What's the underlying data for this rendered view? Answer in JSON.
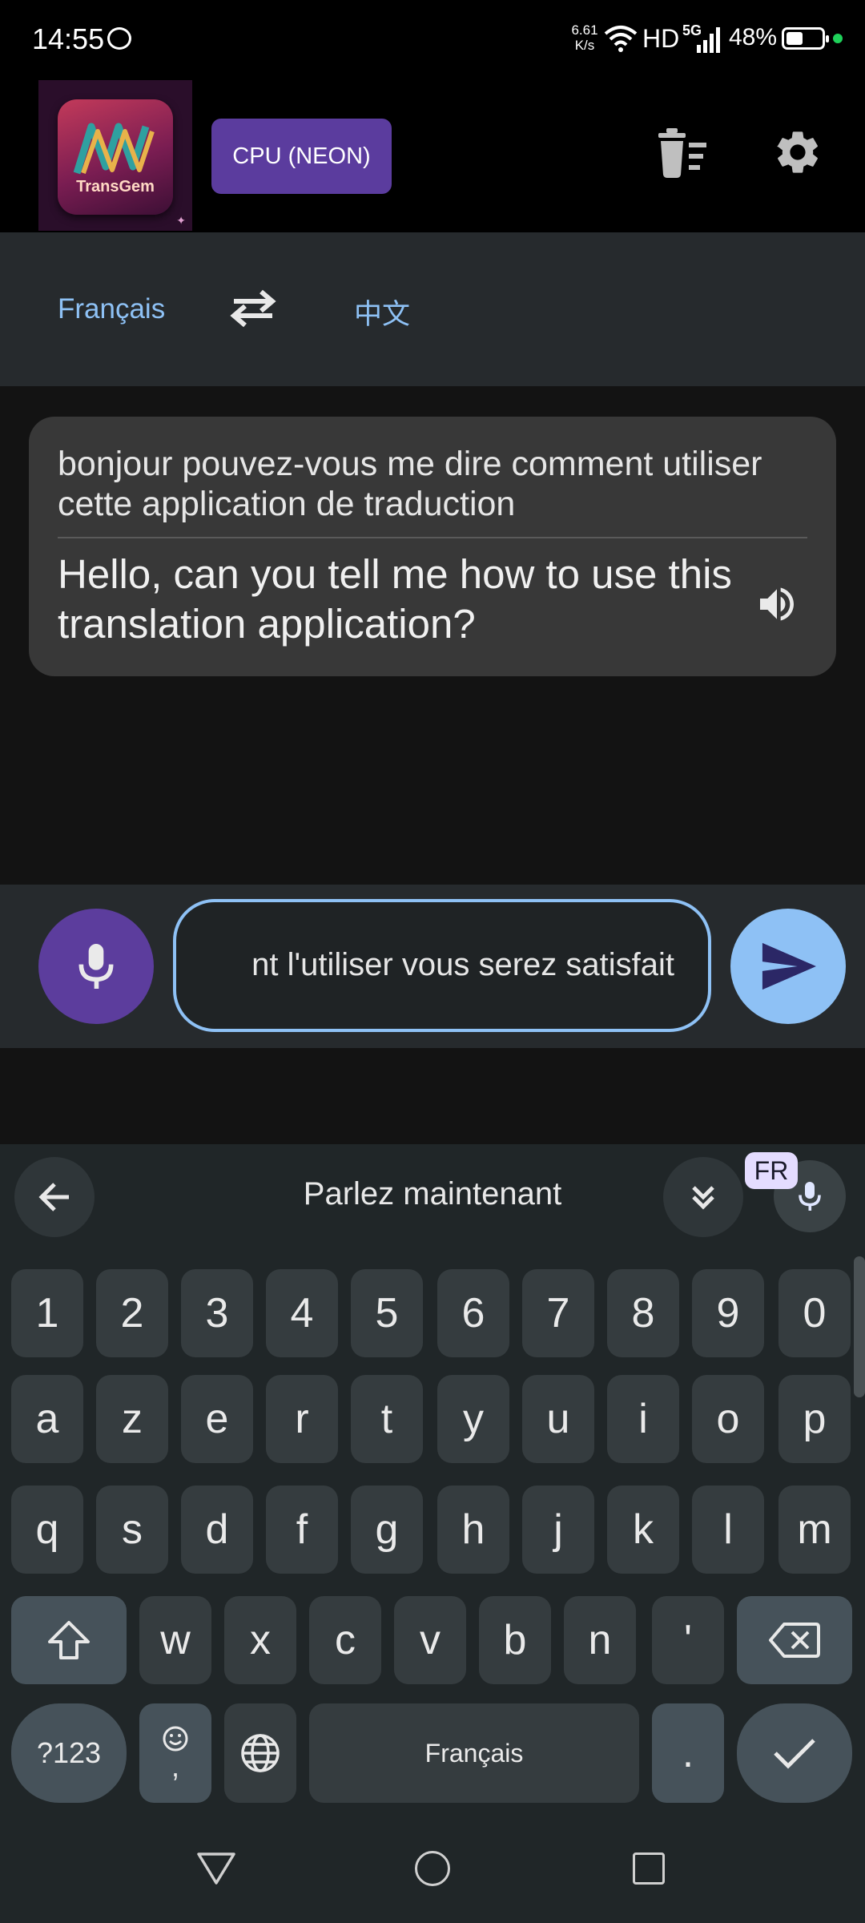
{
  "status_bar": {
    "time": "14:55",
    "net_speed_value": "6.61",
    "net_speed_unit": "K/s",
    "network": "HD",
    "network_gen": "5G",
    "battery_percent": "48%",
    "battery_level": 0.48
  },
  "toolbar": {
    "logo_text": "TransGem",
    "cpu_label": "CPU (NEON)",
    "clear_icon": "clear-history-icon",
    "settings_icon": "gear-icon"
  },
  "languages": {
    "source": "Français",
    "target": "中文",
    "swap_icon": "swap-icon"
  },
  "conversation": [
    {
      "source_text": "bonjour pouvez-vous me dire comment utiliser cette application de traduction",
      "translated_text": "Hello, can you tell me how to use this translation application?"
    }
  ],
  "input": {
    "value": "nt l'utiliser vous serez satisfait"
  },
  "keyboard": {
    "status_text": "Parlez maintenant",
    "language_badge": "FR",
    "row_numbers": [
      "1",
      "2",
      "3",
      "4",
      "5",
      "6",
      "7",
      "8",
      "9",
      "0"
    ],
    "row_1": [
      "a",
      "z",
      "e",
      "r",
      "t",
      "y",
      "u",
      "i",
      "o",
      "p"
    ],
    "row_2": [
      "q",
      "s",
      "d",
      "f",
      "g",
      "h",
      "j",
      "k",
      "l",
      "m"
    ],
    "row_3": [
      "w",
      "x",
      "c",
      "v",
      "b",
      "n",
      "'"
    ],
    "symbols_label": "?123",
    "emoji_key_sub": ",",
    "space_label": "Français",
    "period_label": "."
  },
  "colors": {
    "accent_blue": "#8ec1f5",
    "accent_purple": "#5b3c9e"
  }
}
